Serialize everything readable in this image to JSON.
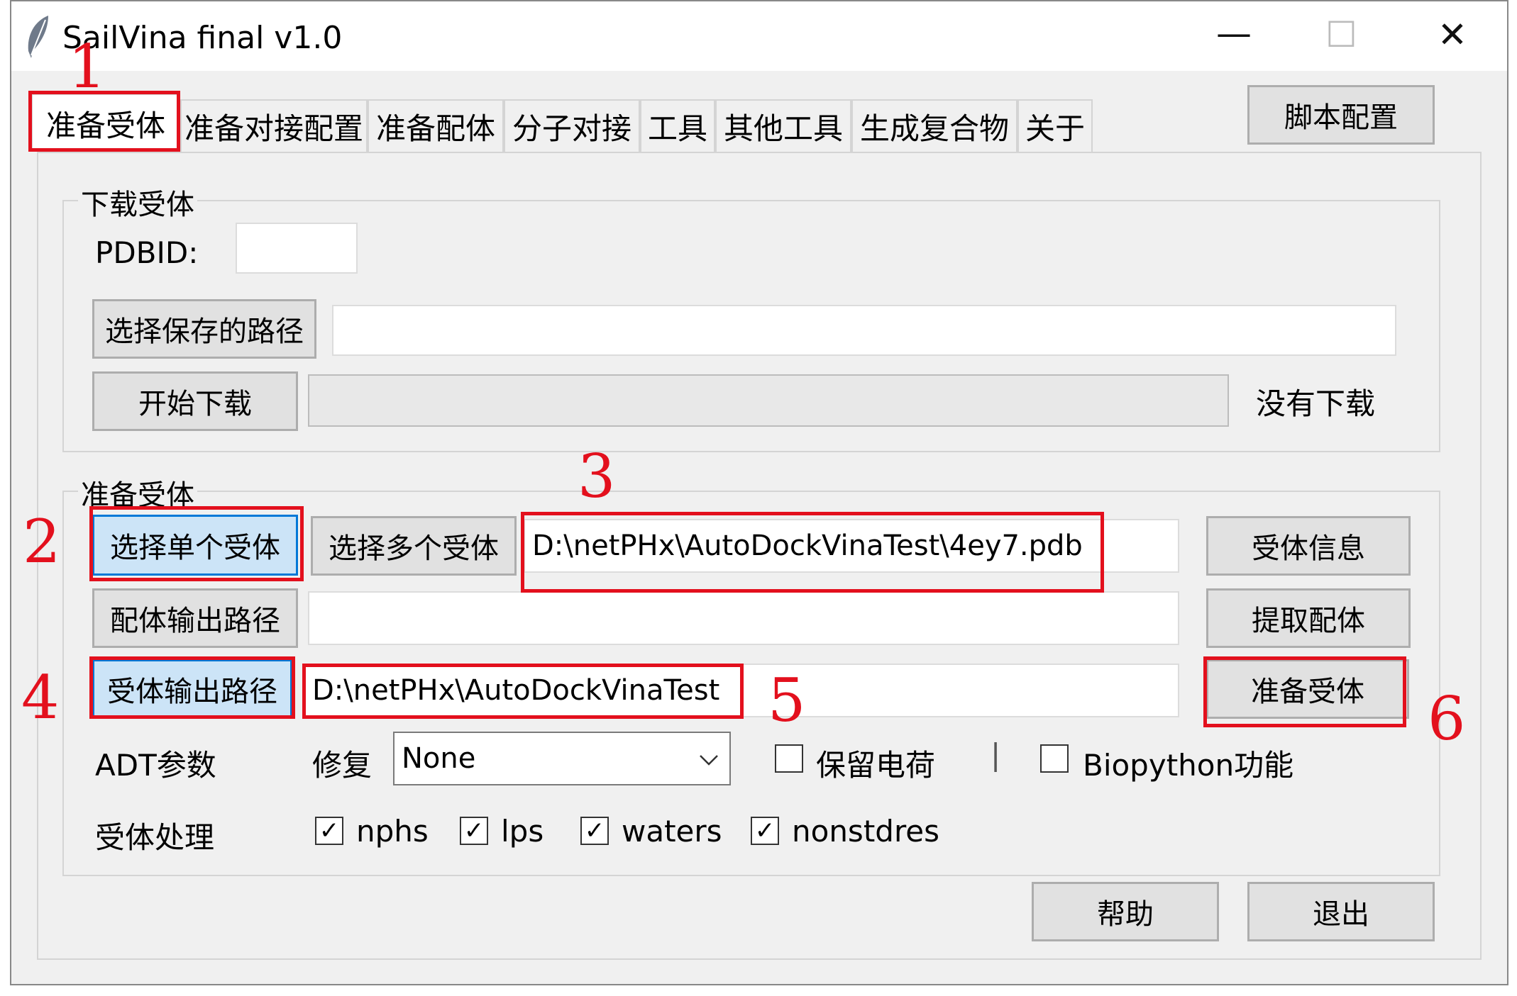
{
  "window": {
    "title": "SailVina final v1.0",
    "minimize_glyph": "—",
    "maximize_glyph": "☐",
    "close_glyph": "✕"
  },
  "tabs": [
    {
      "label": "准备受体",
      "active": true
    },
    {
      "label": "准备对接配置"
    },
    {
      "label": "准备配体"
    },
    {
      "label": "分子对接"
    },
    {
      "label": "工具"
    },
    {
      "label": "其他工具"
    },
    {
      "label": "生成复合物"
    },
    {
      "label": "关于"
    }
  ],
  "script_config_button": "脚本配置",
  "download_group": {
    "title": "下载受体",
    "pdbid_label": "PDBID:",
    "pdbid_value": "",
    "choose_save_path_button": "选择保存的路径",
    "save_path_value": "",
    "start_download_button": "开始下载",
    "progress": 0,
    "status_text": "没有下载"
  },
  "prepare_group": {
    "title": "准备受体",
    "select_single_button": "选择单个受体",
    "select_multiple_button": "选择多个受体",
    "receptor_path_value": "D:\\netPHx\\AutoDockVinaTest\\4ey7.pdb",
    "receptor_info_button": "受体信息",
    "ligand_output_button": "配体输出路径",
    "ligand_output_value": "",
    "extract_ligand_button": "提取配体",
    "receptor_output_button": "受体输出路径",
    "receptor_output_value": "D:\\netPHx\\AutoDockVinaTest",
    "prepare_receptor_button": "准备受体",
    "adt_params_label": "ADT参数",
    "repair_label": "修复",
    "repair_value": "None",
    "keep_charges_label": "保留电荷",
    "keep_charges_checked": false,
    "separator": "|",
    "biopython_label": "Biopython功能",
    "biopython_checked": false,
    "processing_label": "受体处理",
    "options": [
      {
        "label": "nphs",
        "checked": true
      },
      {
        "label": "lps",
        "checked": true
      },
      {
        "label": "waters",
        "checked": true
      },
      {
        "label": "nonstdres",
        "checked": true
      }
    ]
  },
  "footer": {
    "help_button": "帮助",
    "exit_button": "退出"
  },
  "annotations": {
    "color": "#e3101d",
    "markers": [
      "1",
      "2",
      "3",
      "4",
      "5",
      "6"
    ]
  },
  "check_glyph": "✓"
}
